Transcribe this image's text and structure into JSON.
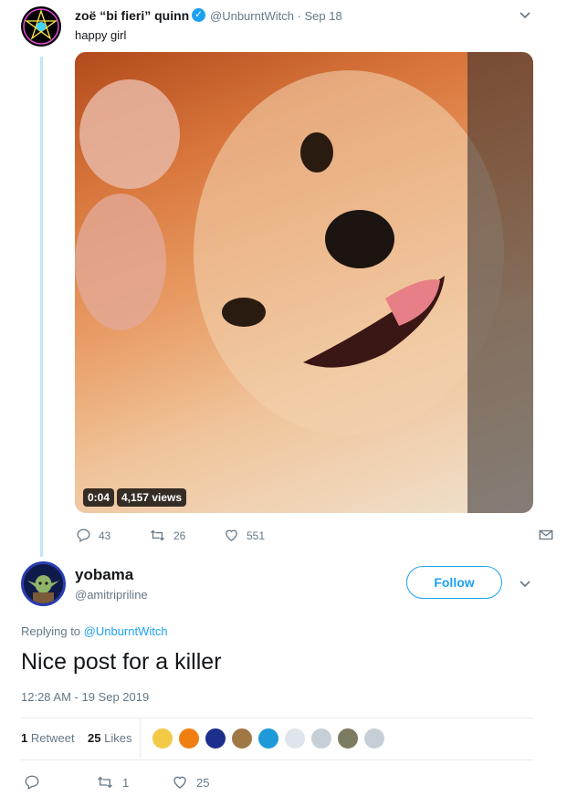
{
  "parent_tweet": {
    "display_name": "zoë “bi fieri” quinn",
    "handle_and_date": "@UnburntWitch · Sep 18",
    "text": "happy girl",
    "video": {
      "duration": "0:04",
      "views": "4,157 views"
    },
    "actions": {
      "replies": "43",
      "retweets": "26",
      "likes": "551"
    }
  },
  "reply_tweet": {
    "display_name": "yobama",
    "handle": "@amitripriline",
    "follow_label": "Follow",
    "replying_to_prefix": "Replying to ",
    "replying_to_handle": "@UnburntWitch",
    "text": "Nice post for a killer",
    "timestamp": "12:28 AM - 19 Sep 2019",
    "stats": {
      "retweets_count": "1",
      "retweets_label": "Retweet",
      "likes_count": "25",
      "likes_label": "Likes"
    },
    "actions": {
      "retweets": "1",
      "likes": "25"
    },
    "likers": [
      {
        "color": "#f3c948"
      },
      {
        "color": "#f07f12"
      },
      {
        "color": "#1c2f8a"
      },
      {
        "color": "#a07846"
      },
      {
        "color": "#1e9ad8"
      },
      {
        "color": "#dfe5ea"
      },
      {
        "color": "#c7cfd6"
      },
      {
        "color": "#7d7a62"
      },
      {
        "color": "#c7cfd6"
      }
    ]
  },
  "colors": {
    "accent": "#1da1f2",
    "secondary_text": "#657786",
    "thread_line": "#c4e4f8"
  },
  "icons": [
    "pentagram-avatar-icon",
    "verified-icon",
    "chevron-down-icon",
    "reply-icon",
    "retweet-icon",
    "heart-icon",
    "direct-message-icon",
    "yoda-avatar-icon"
  ]
}
